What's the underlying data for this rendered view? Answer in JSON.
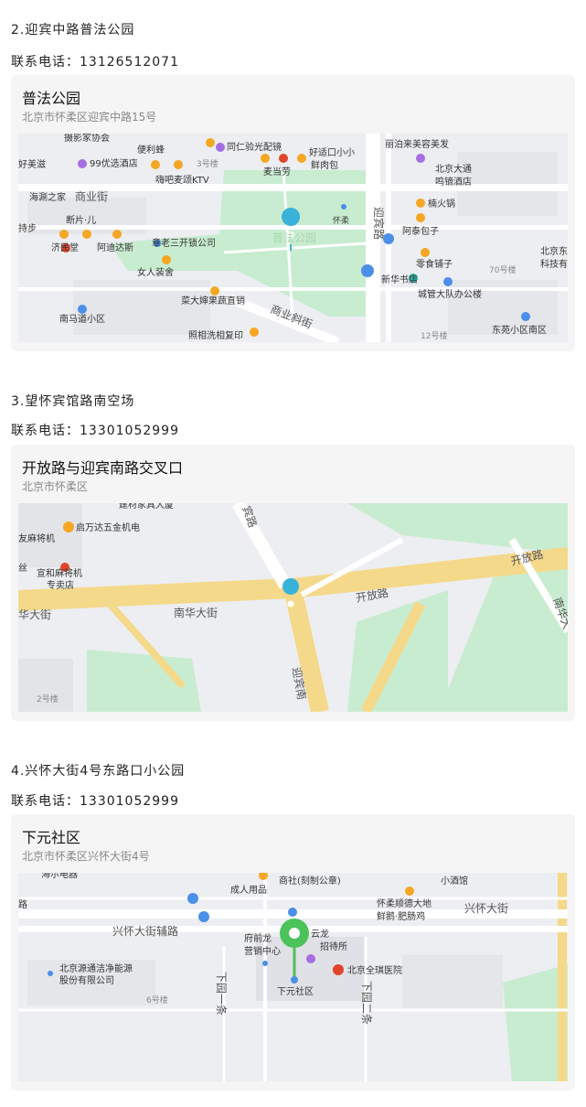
{
  "entries": [
    {
      "heading": "2.迎宾中路普法公园",
      "phone": "联系电话：13126512071",
      "card_title": "普法公园",
      "card_address": "北京市怀柔区迎宾中路15号",
      "map_labels": {
        "l1": "摄影家协会",
        "l2": "便利蜂",
        "l3": "同仁验光配镜",
        "l4": "好适口小小",
        "l5": "鲜肉包",
        "l6": "丽泊来美容美发",
        "l7": "好美滋",
        "l8": "99优选酒店",
        "l9": "3号楼",
        "l10": "麦当劳",
        "l11": "北京大通",
        "l12": "鸣镝酒店",
        "l13": "嗨吧麦颂KTV",
        "l14": "海涮之家",
        "l15": "商业街",
        "l16": "楠火锅",
        "l17": "断片·儿",
        "l18": "怀柔",
        "l19": "阿泰包子",
        "l20": "济民堂",
        "l21": "阿迪达斯",
        "l22": "章老三开锁公司",
        "l23": "普法公园",
        "l24": "北京东",
        "l25": "科技有",
        "l26": "零食铺子",
        "l27": "70号楼",
        "l28": "女人装舍",
        "l29": "新华书店",
        "l30": "城管大队办公楼",
        "l31": "菜大婶果蔬直销",
        "l32": "南马道小区",
        "l33": "东苑小区南区",
        "l34": "照相洗相复印",
        "l35": "12号楼",
        "r1": "迎宾路",
        "r2": "商业斜街",
        "l36": "持步"
      }
    },
    {
      "heading": "3.望怀宾馆路南空场",
      "phone": "联系电话：13301052999",
      "card_title": "开放路与迎宾南路交叉口",
      "card_address": "北京市怀柔区",
      "map_labels": {
        "l1": "建材家具大厦",
        "l2": "启万达五金机电",
        "l3": "友麻将机",
        "l4": "宣和麻将机",
        "l5": "专卖店",
        "l6": "丝",
        "l7": "2号楼",
        "r1": "宾路",
        "r2": "开放路",
        "r3": "开放路",
        "r4": "南华大街",
        "r5": "华大街",
        "r6": "迎宾南",
        "r7": "南华大"
      }
    },
    {
      "heading": "4.兴怀大街4号东路口小公园",
      "phone": "联系电话：13301052999",
      "card_title": "下元社区",
      "card_address": "北京市怀柔区兴怀大街4号",
      "map_labels": {
        "l1": "海尔电器",
        "l2": "商社(刻制公章)",
        "l3": "小酒馆",
        "l4": "成人用品",
        "l5": "怀柔顺德大地",
        "l6": "鲜鹅·肥肠鸡",
        "l7": "府前龙",
        "l8": "云龙",
        "l9": "营销中心",
        "l10": "招待所",
        "l11": "北京全琪医院",
        "l12": "北京源通洁净能源",
        "l13": "股份有限公司",
        "l14": "下元社区",
        "l15": "6号楼",
        "r1": "兴怀大街辅路",
        "r2": "兴怀大街",
        "r3": "下园一条",
        "r4": "下园二条",
        "r5": "路"
      }
    }
  ],
  "colors": {
    "road_major": "#f5d98a",
    "road_major_edge": "#e8c36a",
    "green": "#c8ecd0",
    "block": "#dfe1e6",
    "poi_orange": "#f5a623",
    "poi_purple": "#a56de2",
    "poi_blue": "#4a8fe8",
    "marker_teal": "#38b2d8",
    "marker_green": "#4cc25a"
  }
}
